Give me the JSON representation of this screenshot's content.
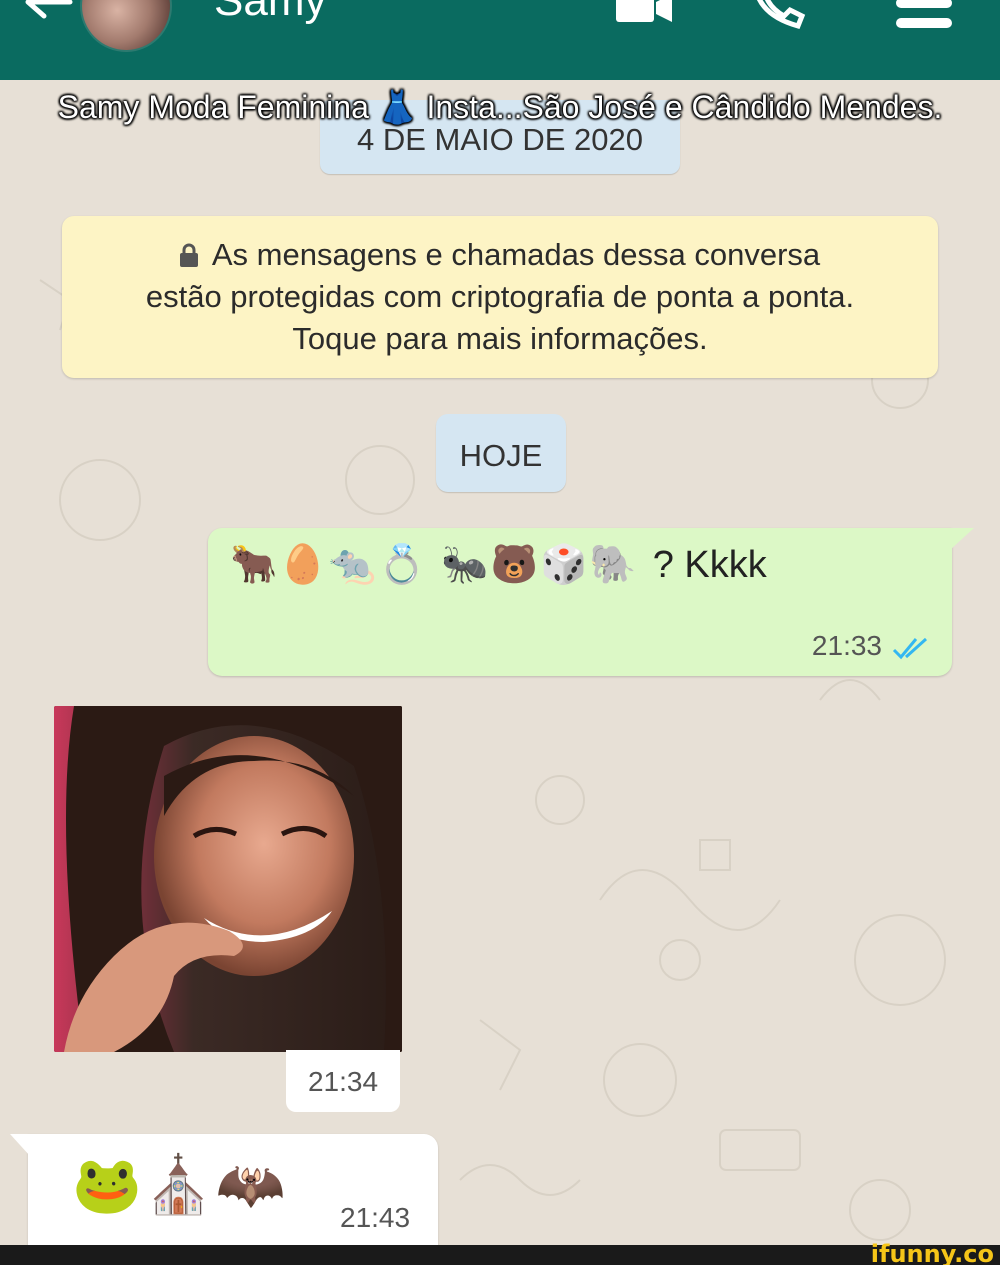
{
  "header": {
    "contact_name": "Samy",
    "back_icon": "back-arrow-icon",
    "video_icon": "video-call-icon",
    "call_icon": "phone-call-icon",
    "menu_icon": "menu-icon",
    "background": "#0a6b60"
  },
  "overlay_caption": "Samy Moda Feminina 👗 Insta...São José e Cândido Mendes.",
  "chat": {
    "date_chip": "4 DE MAIO DE 2020",
    "security_note": {
      "icon": "lock-icon",
      "line1": "As mensagens e chamadas dessa conversa",
      "line2": "estão protegidas com criptografia de ponta a ponta.",
      "line3": "Toque para mais informações."
    },
    "today_chip": "HOJE",
    "messages": [
      {
        "direction": "outgoing",
        "emoji": "🐂🥚🐀💍 🐜🐻🎲🐘",
        "text": "? Kkkk",
        "time": "21:33",
        "status_icon": "double-check-read-icon"
      },
      {
        "direction": "incoming",
        "type": "image",
        "image_description": "photo",
        "time": "21:34"
      },
      {
        "direction": "incoming",
        "emoji": "🐸⛪🦇",
        "time": "21:43"
      }
    ]
  },
  "watermark": "ifunny.co",
  "colors": {
    "outgoing_bubble": "#dcf8c6",
    "incoming_bubble": "#ffffff",
    "chip": "#d5e6f2",
    "security_note": "#fdf4c5",
    "read_ticks": "#34b7f1"
  }
}
